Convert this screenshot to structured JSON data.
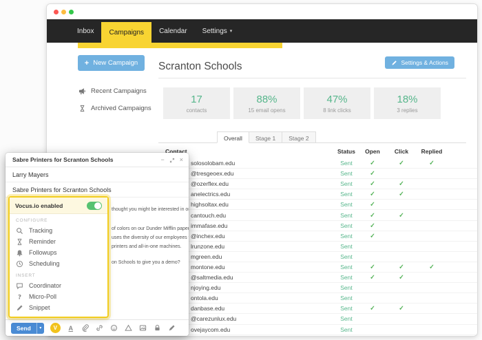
{
  "main_window": {
    "nav": {
      "items": [
        {
          "label": "Inbox"
        },
        {
          "label": "Campaigns"
        },
        {
          "label": "Calendar"
        },
        {
          "label": "Settings"
        }
      ]
    },
    "sidebar": {
      "new_campaign_label": "New Campaign",
      "links": [
        {
          "label": "Recent Campaigns",
          "icon": "megaphone-icon"
        },
        {
          "label": "Archived Campaigns",
          "icon": "hourglass-icon"
        }
      ]
    },
    "header": {
      "title": "Scranton Schools",
      "settings_button_label": "Settings & Actions"
    },
    "stats": [
      {
        "value": "17",
        "label": "contacts"
      },
      {
        "value": "88%",
        "label": "15 email opens"
      },
      {
        "value": "47%",
        "label": "8 link clicks"
      },
      {
        "value": "18%",
        "label": "3 replies"
      }
    ],
    "tabs": [
      {
        "label": "Overall",
        "active": true
      },
      {
        "label": "Stage 1",
        "active": false
      },
      {
        "label": "Stage 2",
        "active": false
      }
    ],
    "table": {
      "headers": [
        "Contact",
        "Status",
        "Open",
        "Click",
        "Replied"
      ],
      "rows": [
        {
          "email": "solosolobam.edu",
          "status": "Sent",
          "open": true,
          "click": true,
          "replied": true
        },
        {
          "email": "@tresgeoex.edu",
          "status": "Sent",
          "open": true,
          "click": false,
          "replied": false
        },
        {
          "email": "@ozerflex.edu",
          "status": "Sent",
          "open": true,
          "click": true,
          "replied": false
        },
        {
          "email": "anelectrics.edu",
          "status": "Sent",
          "open": true,
          "click": true,
          "replied": false
        },
        {
          "email": "highsoltax.edu",
          "status": "Sent",
          "open": true,
          "click": false,
          "replied": false
        },
        {
          "email": "cantouch.edu",
          "status": "Sent",
          "open": true,
          "click": true,
          "replied": false
        },
        {
          "email": "immafase.edu",
          "status": "Sent",
          "open": true,
          "click": false,
          "replied": false
        },
        {
          "email": "@inchex.edu",
          "status": "Sent",
          "open": true,
          "click": false,
          "replied": false
        },
        {
          "email": "lrunzone.edu",
          "status": "Sent",
          "open": false,
          "click": false,
          "replied": false
        },
        {
          "email": "mgreen.edu",
          "status": "Sent",
          "open": false,
          "click": false,
          "replied": false
        },
        {
          "email": "montone.edu",
          "status": "Sent",
          "open": true,
          "click": true,
          "replied": true
        },
        {
          "email": "@saltmedia.edu",
          "status": "Sent",
          "open": true,
          "click": true,
          "replied": false
        },
        {
          "email": "njoying.edu",
          "status": "Sent",
          "open": false,
          "click": false,
          "replied": false
        },
        {
          "email": "ontola.edu",
          "status": "Sent",
          "open": false,
          "click": false,
          "replied": false
        },
        {
          "email": "danbase.edu",
          "status": "Sent",
          "open": true,
          "click": true,
          "replied": false
        },
        {
          "email": "@carezunlux.edu",
          "status": "Sent",
          "open": false,
          "click": false,
          "replied": false
        },
        {
          "email": "ovejaycom.edu",
          "status": "Sent",
          "open": false,
          "click": false,
          "replied": false
        }
      ]
    }
  },
  "compose": {
    "title": "Sabre Printers for Scranton Schools",
    "to": "Larry Mayers",
    "subject": "Sabre Printers for Scranton Schools",
    "body_fragments": [
      "thought you might be interested in one of",
      "of colors on our Dunder Mifflin paper.",
      "uses the diversity of our employees to",
      "printers and all-in-one machines.",
      "on Schools to give you a demo?"
    ],
    "vocus_panel": {
      "toggle_label": "Vocus.io enabled",
      "toggle_on": true,
      "sections": [
        {
          "label": "CONFIGURE",
          "items": [
            {
              "icon": "magnifier-icon",
              "label": "Tracking"
            },
            {
              "icon": "hourglass-icon",
              "label": "Reminder"
            },
            {
              "icon": "bell-icon",
              "label": "Followups"
            },
            {
              "icon": "clock-icon",
              "label": "Scheduling"
            }
          ]
        },
        {
          "label": "INSERT",
          "items": [
            {
              "icon": "speech-bubble-icon",
              "label": "Coordinator"
            },
            {
              "icon": "question-icon",
              "label": "Micro-Poll"
            },
            {
              "icon": "pencil-icon",
              "label": "Snippet"
            }
          ]
        }
      ]
    },
    "toolbar": {
      "send_label": "Send",
      "vocus_badge": "V",
      "icons": [
        "format-icon",
        "attach-icon",
        "link-icon",
        "emoji-icon",
        "drive-icon",
        "image-icon",
        "lock-icon",
        "pen-icon"
      ]
    }
  },
  "colors": {
    "accent_yellow": "#f8d432",
    "accent_blue": "#70b1e0",
    "send_blue": "#4a8bd4",
    "stat_green": "#56b68b",
    "check_green": "#4caf50",
    "nav_dark": "#262626"
  }
}
